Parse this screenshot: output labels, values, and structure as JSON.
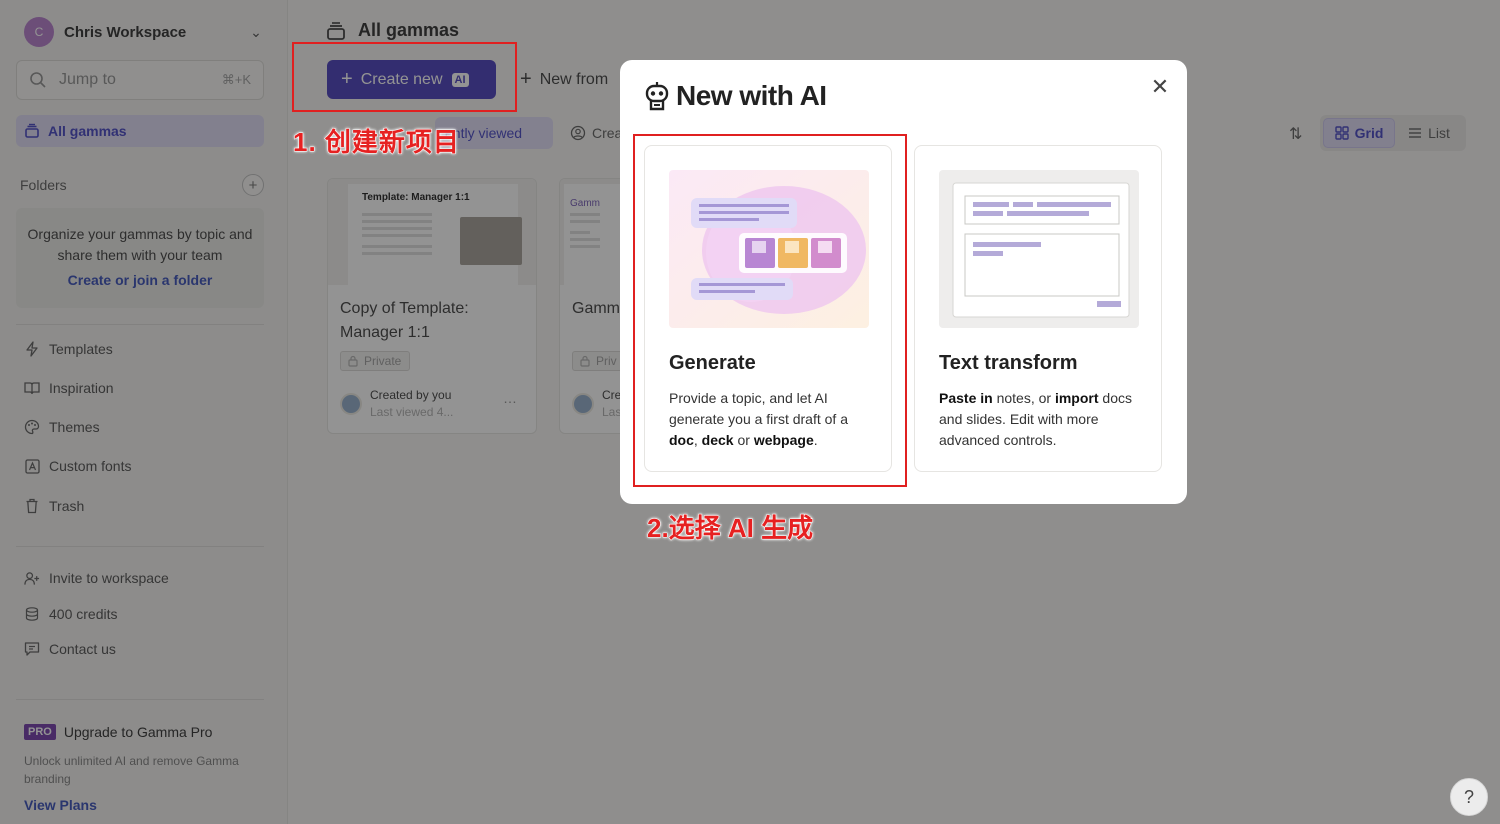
{
  "sidebar": {
    "workspace_initial": "C",
    "workspace_name": "Chris Workspace",
    "search_placeholder": "Jump to",
    "search_shortcut": "⌘+K",
    "active_item": "All gammas",
    "folders_label": "Folders",
    "folder_hint": "Organize your gammas by topic and share them with your team",
    "folder_link": "Create or join a folder",
    "items": [
      {
        "label": "Templates",
        "icon": "lightning-icon"
      },
      {
        "label": "Inspiration",
        "icon": "book-icon"
      },
      {
        "label": "Themes",
        "icon": "palette-icon"
      },
      {
        "label": "Custom fonts",
        "icon": "font-icon"
      },
      {
        "label": "Trash",
        "icon": "trash-icon"
      }
    ],
    "secondary": [
      {
        "label": "Invite to workspace",
        "icon": "add-user-icon"
      },
      {
        "label": "400 credits",
        "icon": "coins-icon"
      },
      {
        "label": "Contact us",
        "icon": "chat-icon"
      }
    ],
    "pro_badge": "PRO",
    "pro_title": "Upgrade to Gamma Pro",
    "pro_sub": "Unlock unlimited AI and remove Gamma branding",
    "view_plans": "View Plans"
  },
  "main": {
    "page_title": "All gammas",
    "create_new": "Create new",
    "ai_badge": "AI",
    "new_from": "New from",
    "chip_recent": "ently viewed",
    "chip_created": "Crea",
    "grid_label": "Grid",
    "list_label": "List",
    "cards": [
      {
        "thumb_title": "Template: Manager 1:1",
        "title": "Copy of Template: Manager 1:1",
        "privacy": "Private",
        "owner": "Created by you",
        "viewed": "Last viewed 4..."
      },
      {
        "thumb_title": "Gamm",
        "title": "Gamm",
        "privacy": "Priv",
        "owner": "Cre",
        "viewed": "Las"
      }
    ]
  },
  "modal": {
    "title": "New with AI",
    "generate_title": "Generate",
    "generate_desc_pre": "Provide a topic, and let AI generate you a first draft of a ",
    "generate_desc_b1": "doc",
    "generate_desc_sep1": ", ",
    "generate_desc_b2": "deck",
    "generate_desc_sep2": " or ",
    "generate_desc_b3": "webpage",
    "generate_desc_end": ".",
    "transform_title": "Text transform",
    "transform_b1": "Paste in",
    "transform_mid": " notes, or ",
    "transform_b2": "import",
    "transform_end": " docs and slides. Edit with more advanced controls."
  },
  "annotations": {
    "step1": "1. 创建新项目",
    "step2": "2.选择 AI 生成"
  },
  "help": "?",
  "colors": {
    "accent": "#3f33b8",
    "annotation": "#e02020"
  }
}
